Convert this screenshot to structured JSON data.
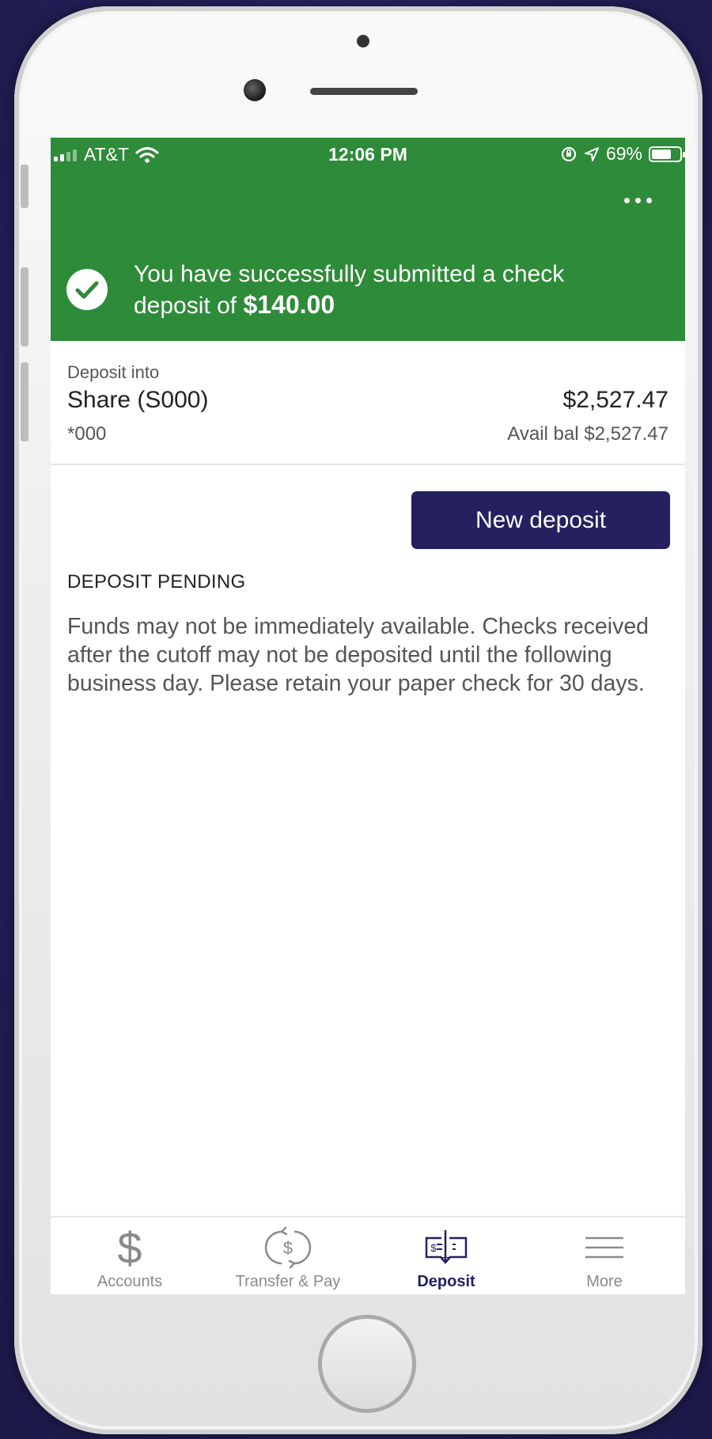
{
  "status_bar": {
    "carrier": "AT&T",
    "time": "12:06 PM",
    "battery_percent": "69%"
  },
  "header": {
    "success_message": "You have successfully submitted a check deposit of",
    "deposit_amount": "$140.00",
    "accent_color": "#2e8b39"
  },
  "account": {
    "label": "Deposit into",
    "name": "Share (S000)",
    "number": "*000",
    "balance": "$2,527.47",
    "available": "Avail bal $2,527.47"
  },
  "actions": {
    "new_deposit_label": "New deposit",
    "button_color": "#25205f"
  },
  "notice": {
    "title": "DEPOSIT PENDING",
    "body": "Funds may not be immediately available. Checks received after the cutoff may not be deposited until the following business day. Please retain your paper check for 30 days."
  },
  "tabbar": {
    "items": [
      {
        "label": "Accounts",
        "icon": "dollar-icon",
        "active": false
      },
      {
        "label": "Transfer & Pay",
        "icon": "transfer-icon",
        "active": false
      },
      {
        "label": "Deposit",
        "icon": "check-deposit-icon",
        "active": true
      },
      {
        "label": "More",
        "icon": "hamburger-icon",
        "active": false
      }
    ]
  }
}
